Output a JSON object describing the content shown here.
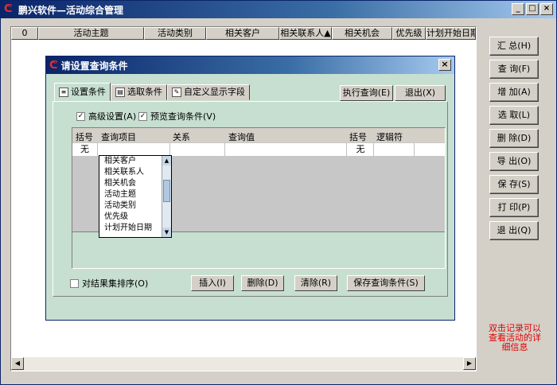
{
  "window": {
    "title": "鹏兴软件—活动综合管理",
    "min": "_",
    "max": "□",
    "close": "×"
  },
  "grid": {
    "columns": [
      "0",
      "活动主题",
      "活动类别",
      "相关客户",
      "相关联系人▲",
      "相关机会",
      "优先级",
      "计划开始日期"
    ]
  },
  "side_buttons": [
    "汇 总(H)",
    "查 询(F)",
    "增 加(A)",
    "选 取(L)",
    "删 除(D)",
    "导 出(O)",
    "保 存(S)",
    "打 印(P)",
    "退 出(Q)"
  ],
  "note": "双击记录可以查看活动的详细信息",
  "dialog": {
    "title": "请设置查询条件",
    "tabs": [
      "设置条件",
      "选取条件",
      "自定义显示字段"
    ],
    "run_query": "执行查询(E)",
    "exit": "退出(X)",
    "advanced": "高级设置(A)",
    "preview": "预览查询条件(V)",
    "table_headers": [
      "括号",
      "查询项目",
      "关系",
      "查询值",
      "括号",
      "逻辑符"
    ],
    "row": {
      "left_paren": "无",
      "right_paren": "无"
    },
    "dropdown_items": [
      "相关客户",
      "相关联系人",
      "相关机会",
      "活动主题",
      "活动类别",
      "优先级",
      "计划开始日期"
    ],
    "sort_label": "对结果集排序(O)",
    "insert": "插入(I)",
    "delete": "删除(D)",
    "clear": "清除(R)",
    "save": "保存查询条件(S)"
  }
}
